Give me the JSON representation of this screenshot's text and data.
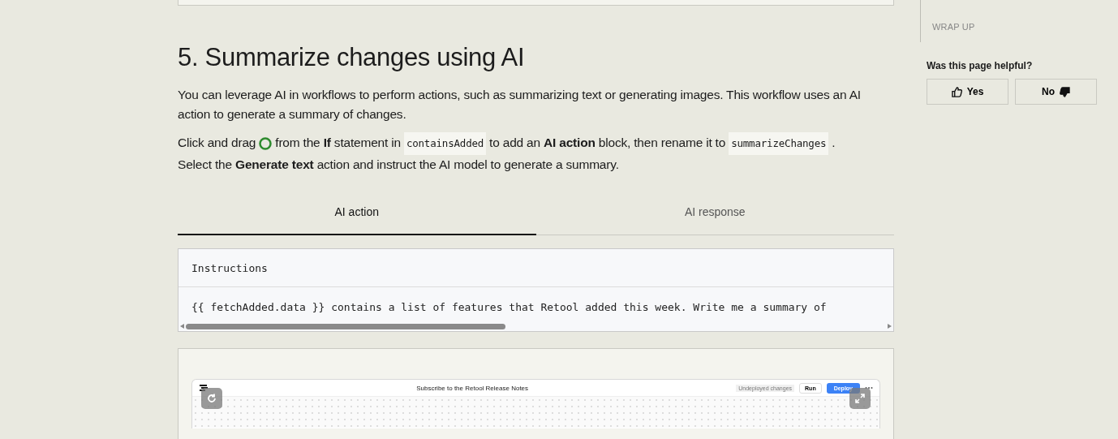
{
  "section": {
    "heading": "5. Summarize changes using AI",
    "intro": "You can leverage AI in workflows to perform actions, such as summarizing text or generating images. This workflow uses an AI action to generate a summary of changes.",
    "steps": [
      [
        {
          "kind": "text",
          "text": "Click and drag"
        },
        {
          "kind": "circle"
        },
        {
          "kind": "text",
          "text": "from the **If** statement in"
        },
        {
          "kind": "code",
          "text": "containsAdded"
        },
        {
          "kind": "text",
          "text": "to add an **AI action** block, then rename it to"
        },
        {
          "kind": "code",
          "text": "summarizeChanges"
        },
        {
          "kind": "text",
          "text": "."
        }
      ],
      [
        {
          "kind": "text",
          "text": "Select the **Generate text** action and instruct the AI model to generate a summary."
        }
      ]
    ]
  },
  "tabs": [
    {
      "label": "AI action",
      "selected": true
    },
    {
      "label": "AI response",
      "selected": false
    }
  ],
  "code_block": {
    "header": "Instructions",
    "line": "{{ fetchAdded.data }} contains a list of features that Retool added this week. Write me a summary of"
  },
  "screenshot": {
    "title": "Subscribe to the Retool Release Notes",
    "status": "Undeployed changes",
    "run_button": "Run",
    "deploy_button": "Deploy"
  },
  "sidebar": {
    "toc_item": "WRAP UP",
    "question": "Was this page helpful?",
    "buttons": [
      {
        "label": "Yes",
        "kind": "up"
      },
      {
        "label": "No",
        "kind": "down"
      }
    ]
  }
}
